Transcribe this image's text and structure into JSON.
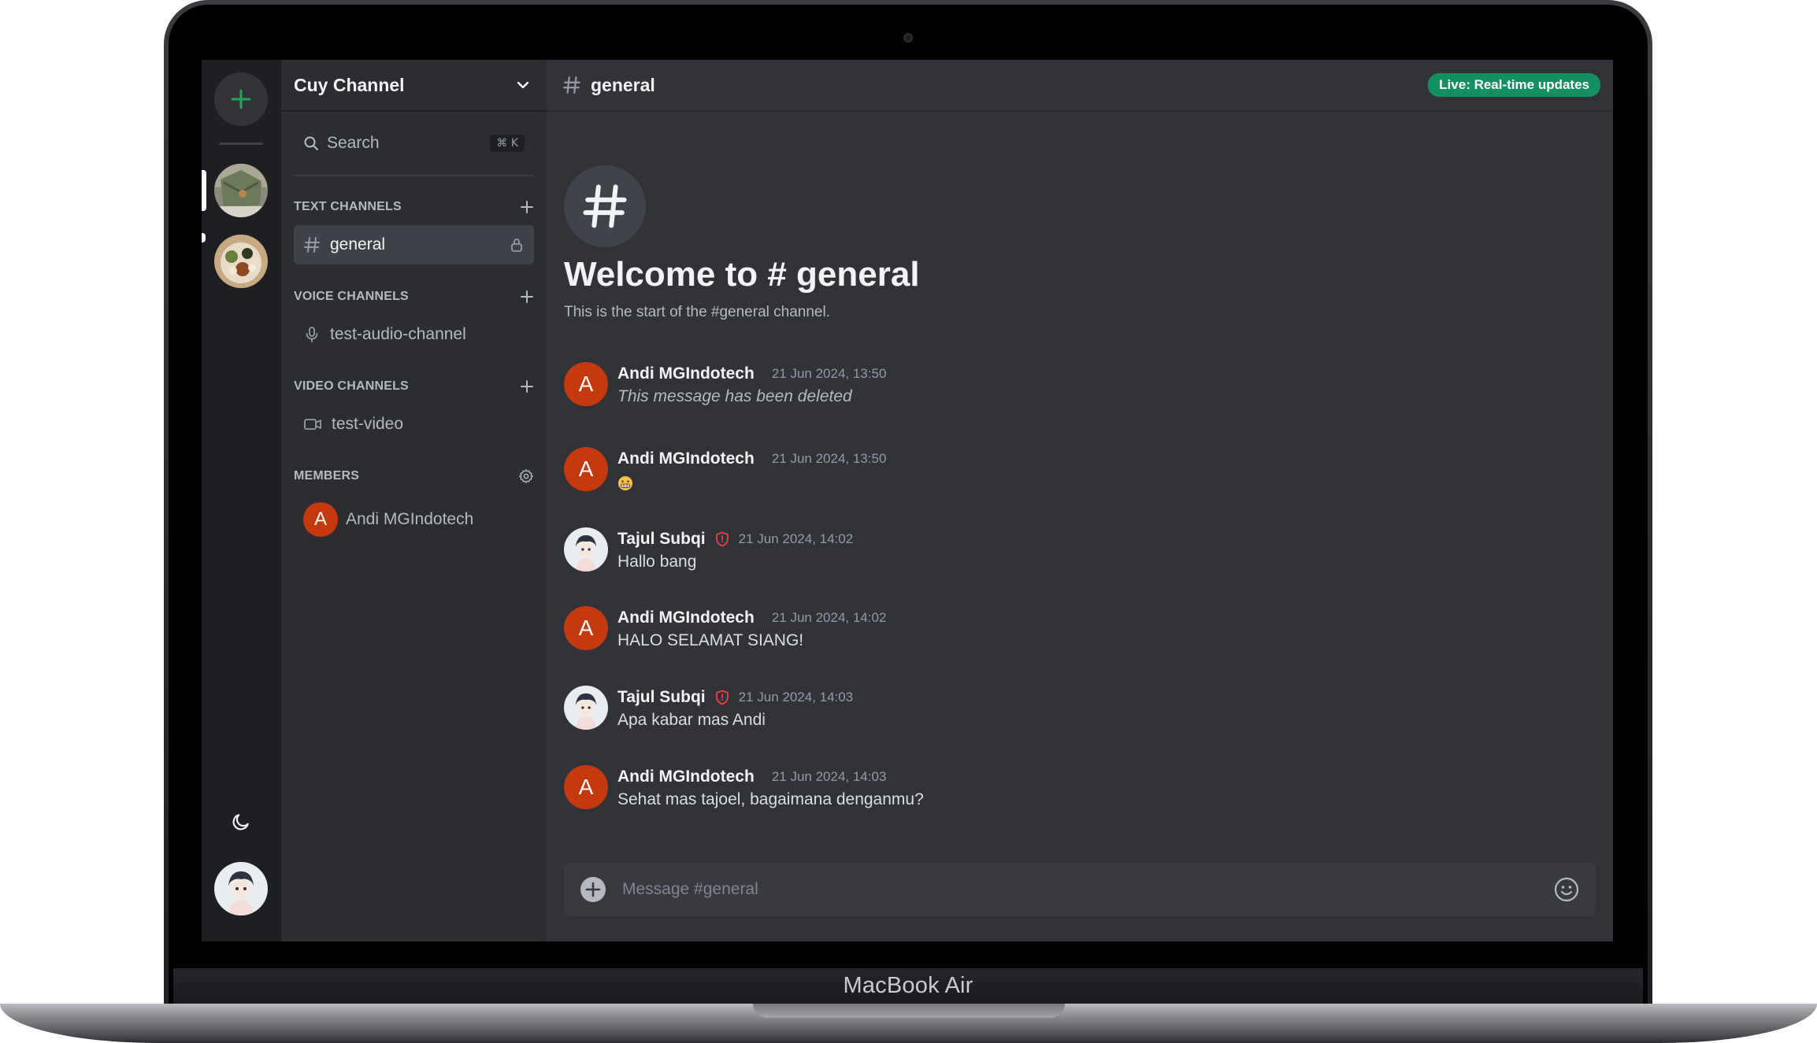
{
  "device": {
    "label": "MacBook Air"
  },
  "server": {
    "name": "Cuy Channel",
    "search_label": "Search",
    "search_shortcut": "⌘ K"
  },
  "sections": {
    "text": {
      "title": "TEXT CHANNELS",
      "channels": [
        {
          "name": "general"
        }
      ]
    },
    "voice": {
      "title": "VOICE CHANNELS",
      "channels": [
        {
          "name": "test-audio-channel"
        }
      ]
    },
    "video": {
      "title": "VIDEO CHANNELS",
      "channels": [
        {
          "name": "test-video"
        }
      ]
    },
    "members": {
      "title": "MEMBERS",
      "list": [
        {
          "name": "Andi MGIndotech",
          "initial": "A"
        }
      ]
    }
  },
  "channel": {
    "name": "general",
    "live_badge": "Live: Real-time updates",
    "welcome_title": "Welcome to # general",
    "welcome_subtitle": "This is the start of the #general channel."
  },
  "messages": [
    {
      "initial": "A",
      "author": "Andi MGIndotech",
      "time": "21 Jun 2024, 13:50",
      "text": "This message has been deleted"
    },
    {
      "initial": "A",
      "author": "Andi MGIndotech",
      "time": "21 Jun 2024, 13:50",
      "text": ""
    },
    {
      "author": "Tajul Subqi",
      "time": "21 Jun 2024, 14:02",
      "text": "Hallo bang"
    },
    {
      "initial": "A",
      "author": "Andi MGIndotech",
      "time": "21 Jun 2024, 14:02",
      "text": "HALO SELAMAT SIANG!"
    },
    {
      "author": "Tajul Subqi",
      "time": "21 Jun 2024, 14:03",
      "text": "Apa kabar mas Andi"
    },
    {
      "initial": "A",
      "author": "Andi MGIndotech",
      "time": "21 Jun 2024, 14:03",
      "text": "Sehat mas tajoel, bagaimana denganmu?"
    }
  ],
  "composer": {
    "placeholder": "Message #general"
  },
  "colors": {
    "accent_green": "#139163",
    "avatar_red": "#c6390e",
    "mod_badge": "#f23f43",
    "add_server": "#23a55a"
  }
}
